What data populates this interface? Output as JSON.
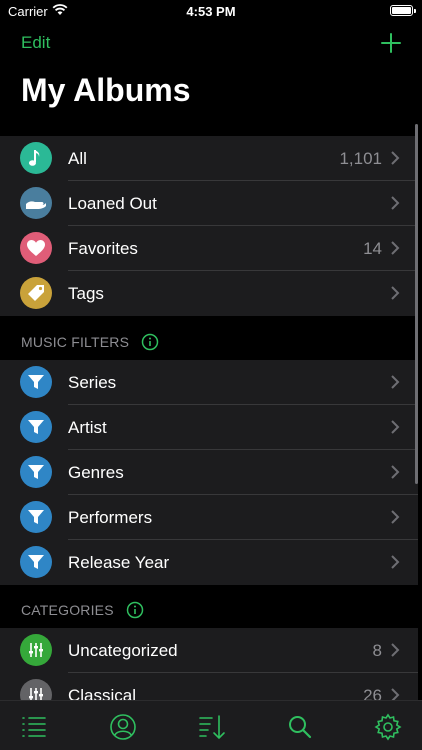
{
  "status": {
    "carrier": "Carrier",
    "time": "4:53 PM"
  },
  "nav": {
    "edit_label": "Edit",
    "title": "My Albums"
  },
  "colors": {
    "accent": "#2fbf5f",
    "all": "#2bb996",
    "loaned": "#4a7e9e",
    "favorites": "#e05d78",
    "tags": "#c9a23a",
    "filter": "#2f86c6",
    "uncategorized": "#35a83a",
    "classical": "#636366"
  },
  "main_group": {
    "items": [
      {
        "label": "All",
        "count": "1,101",
        "icon": "music-note-icon"
      },
      {
        "label": "Loaned Out",
        "count": "",
        "icon": "hand-icon"
      },
      {
        "label": "Favorites",
        "count": "14",
        "icon": "heart-icon"
      },
      {
        "label": "Tags",
        "count": "",
        "icon": "tag-icon"
      }
    ]
  },
  "music_filters": {
    "header": "MUSIC FILTERS",
    "items": [
      {
        "label": "Series",
        "icon": "filter-icon"
      },
      {
        "label": "Artist",
        "icon": "filter-icon"
      },
      {
        "label": "Genres",
        "icon": "filter-icon"
      },
      {
        "label": "Performers",
        "icon": "filter-icon"
      },
      {
        "label": "Release Year",
        "icon": "filter-icon"
      }
    ]
  },
  "categories": {
    "header": "CATEGORIES",
    "items": [
      {
        "label": "Uncategorized",
        "count": "8",
        "icon": "sliders-icon"
      },
      {
        "label": "Classical",
        "count": "26",
        "icon": "sliders-icon"
      }
    ]
  },
  "tab_bar": {
    "items": [
      "list-icon",
      "person-icon",
      "sort-icon",
      "search-icon",
      "gear-icon"
    ]
  }
}
